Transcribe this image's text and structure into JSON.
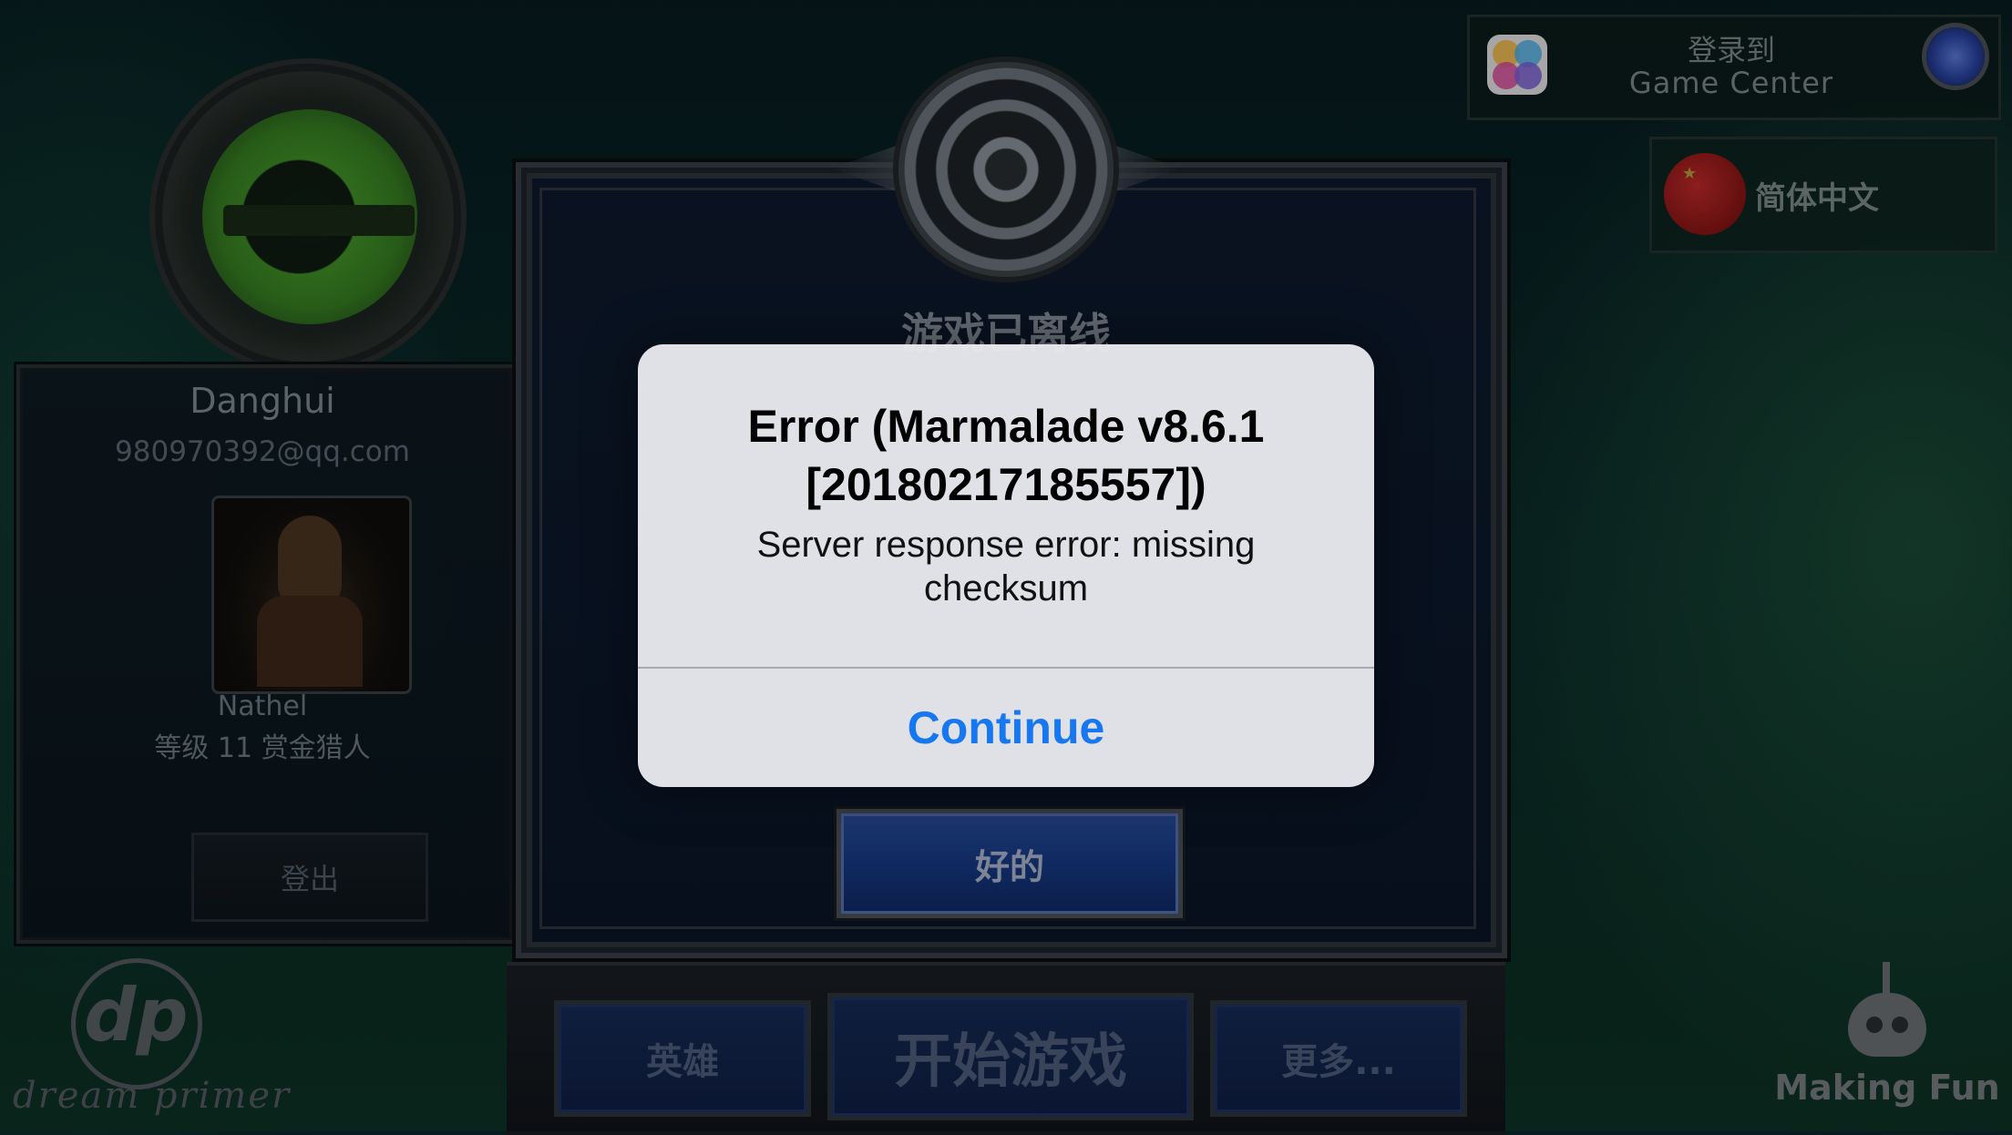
{
  "profile": {
    "username": "Danghui",
    "email": "980970392@qq.com",
    "character_name": "Nathel",
    "character_level": "等级 11 赏金猎人",
    "logout_label": "登出"
  },
  "branding": {
    "developer_logo": "dp",
    "developer_name": "dream primer",
    "studio_name": "Making Fun"
  },
  "game_dialog": {
    "title": "游戏已离线",
    "ok_label": "好的"
  },
  "bottom_bar": {
    "heroes_label": "英雄",
    "start_label": "开始游戏",
    "more_label": "更多..."
  },
  "game_center": {
    "line1": "登录到",
    "line2": "Game Center"
  },
  "language": {
    "label": "简体中文"
  },
  "alert": {
    "title": "Error (Marmalade v8.6.1 [20180217185557])",
    "message": "Server response error: missing checksum",
    "button_label": "Continue"
  },
  "icons": {
    "emblem": "emblem-e-icon",
    "gear": "gear-icon",
    "game_center": "game-center-icon",
    "flag": "china-flag-icon",
    "robot": "making-fun-robot-icon"
  },
  "colors": {
    "alert_button": "#1677f0",
    "ok_button": "#163a86"
  }
}
